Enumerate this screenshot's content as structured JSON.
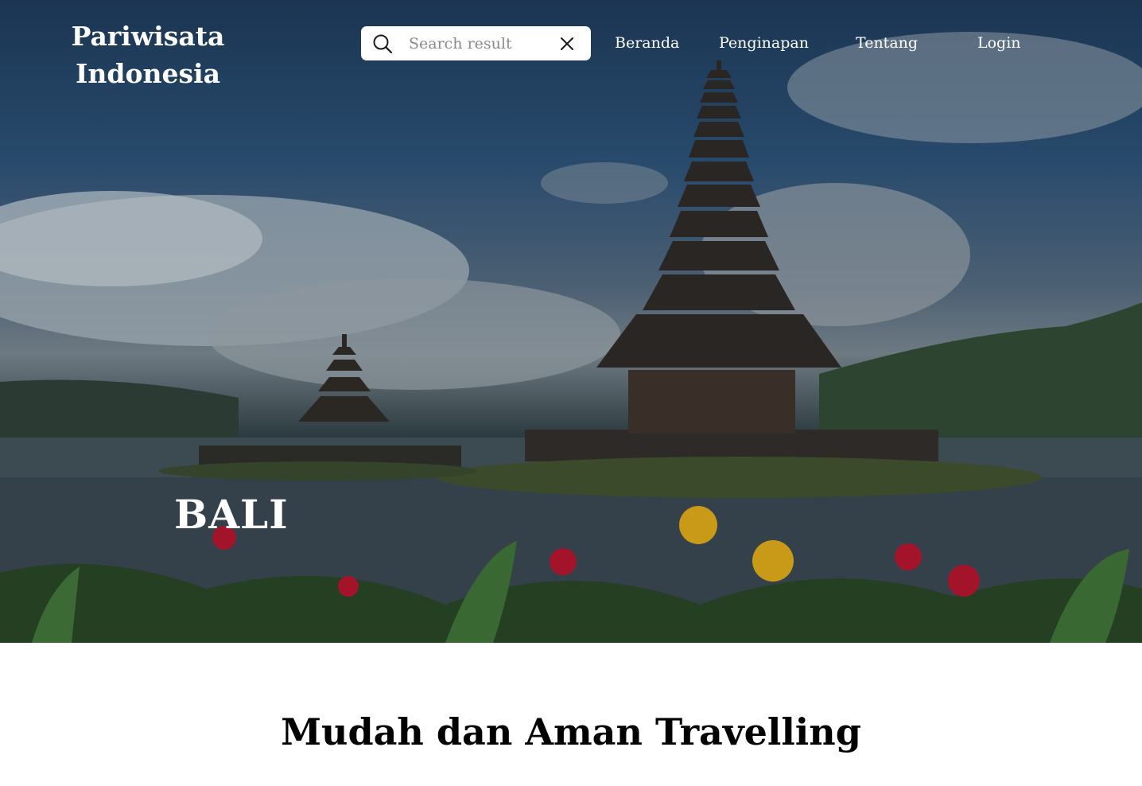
{
  "brand": {
    "line1": "Pariwisata",
    "line2": "Indonesia"
  },
  "search": {
    "placeholder": "Search result",
    "value": "",
    "icon": "search-icon",
    "clear_icon": "close-icon"
  },
  "nav": [
    {
      "label": "Beranda"
    },
    {
      "label": "Penginapan"
    },
    {
      "label": "Tentang"
    },
    {
      "label": "Login"
    }
  ],
  "hero": {
    "title": "BALI"
  },
  "section": {
    "title": "Mudah dan Aman Travelling"
  },
  "colors": {
    "text_on_hero": "#ffffff",
    "search_bg": "#ffffff",
    "section_text": "#000000"
  }
}
